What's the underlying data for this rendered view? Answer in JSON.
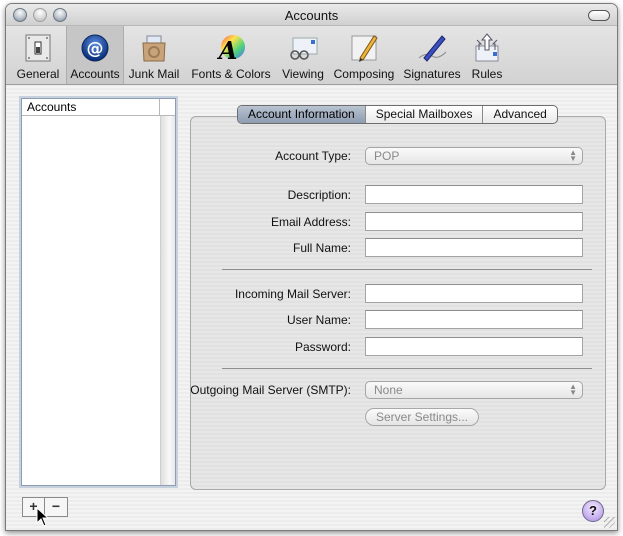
{
  "window": {
    "title": "Accounts"
  },
  "toolbar": {
    "items": [
      {
        "label": "General",
        "icon": "light-switch-icon",
        "selected": false
      },
      {
        "label": "Accounts",
        "icon": "at-sign-icon",
        "selected": true
      },
      {
        "label": "Junk Mail",
        "icon": "recycle-bag-icon",
        "selected": false
      },
      {
        "label": "Fonts & Colors",
        "icon": "color-wheel-font-icon",
        "selected": false
      },
      {
        "label": "Viewing",
        "icon": "glasses-envelope-icon",
        "selected": false
      },
      {
        "label": "Composing",
        "icon": "pencil-paper-icon",
        "selected": false
      },
      {
        "label": "Signatures",
        "icon": "pen-signature-icon",
        "selected": false
      },
      {
        "label": "Rules",
        "icon": "arrows-envelope-icon",
        "selected": false
      }
    ]
  },
  "accounts_list": {
    "header": "Accounts",
    "items": []
  },
  "list_buttons": {
    "add": "+",
    "remove": "−"
  },
  "tabs": [
    {
      "label": "Account Information",
      "active": true
    },
    {
      "label": "Special Mailboxes",
      "active": false
    },
    {
      "label": "Advanced",
      "active": false
    }
  ],
  "form": {
    "account_type": {
      "label": "Account Type:",
      "value": "POP"
    },
    "description": {
      "label": "Description:",
      "value": ""
    },
    "email": {
      "label": "Email Address:",
      "value": ""
    },
    "full_name": {
      "label": "Full Name:",
      "value": ""
    },
    "incoming_server": {
      "label": "Incoming Mail Server:",
      "value": ""
    },
    "user_name": {
      "label": "User Name:",
      "value": ""
    },
    "password": {
      "label": "Password:",
      "value": ""
    },
    "outgoing_server": {
      "label": "Outgoing Mail Server (SMTP):",
      "value": "None"
    },
    "server_settings_label": "Server Settings..."
  },
  "help": {
    "label": "?"
  }
}
